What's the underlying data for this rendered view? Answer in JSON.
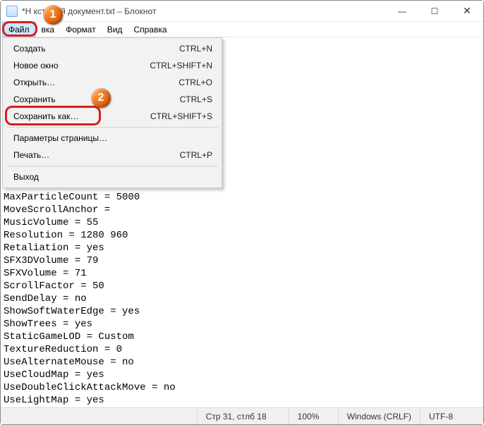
{
  "title": "*Н         кстовый документ.txt – Блокнот",
  "menubar": {
    "file": "Файл",
    "edit": "    вка",
    "format": "Формат",
    "view": "Вид",
    "help": "Справка"
  },
  "dropdown": {
    "items": [
      {
        "label": "Создать",
        "shortcut": "CTRL+N"
      },
      {
        "label": "Новое окно",
        "shortcut": "CTRL+SHIFT+N"
      },
      {
        "label": "Открыть…",
        "shortcut": "CTRL+O"
      },
      {
        "label": "Сохранить",
        "shortcut": "CTRL+S"
      },
      {
        "label": "Сохранить как…",
        "shortcut": "CTRL+SHIFT+S"
      },
      {
        "label": "Параметры страницы…",
        "shortcut": ""
      },
      {
        "label": "Печать…",
        "shortcut": "CTRL+P"
      },
      {
        "label": "Выход",
        "shortcut": ""
      }
    ]
  },
  "editor_lines": [
    "",
    "",
    "",
    "",
    "",
    "",
    "",
    "",
    "",
    "",
    "",
    "",
    "MaxParticleCount = 5000",
    "MoveScrollAnchor =",
    "MusicVolume = 55",
    "Resolution = 1280 960",
    "Retaliation = yes",
    "SFX3DVolume = 79",
    "SFXVolume = 71",
    "ScrollFactor = 50",
    "SendDelay = no",
    "ShowSoftWaterEdge = yes",
    "ShowTrees = yes",
    "StaticGameLOD = Custom",
    "TextureReduction = 0",
    "UseAlternateMouse = no",
    "UseCloudMap = yes",
    "UseDoubleClickAttackMove = no",
    "UseLightMap = yes"
  ],
  "statusbar": {
    "pos": "Стр 31, стлб 18",
    "zoom": "100%",
    "eol": "Windows (CRLF)",
    "enc": "UTF-8"
  },
  "callouts": {
    "one": "1",
    "two": "2"
  }
}
